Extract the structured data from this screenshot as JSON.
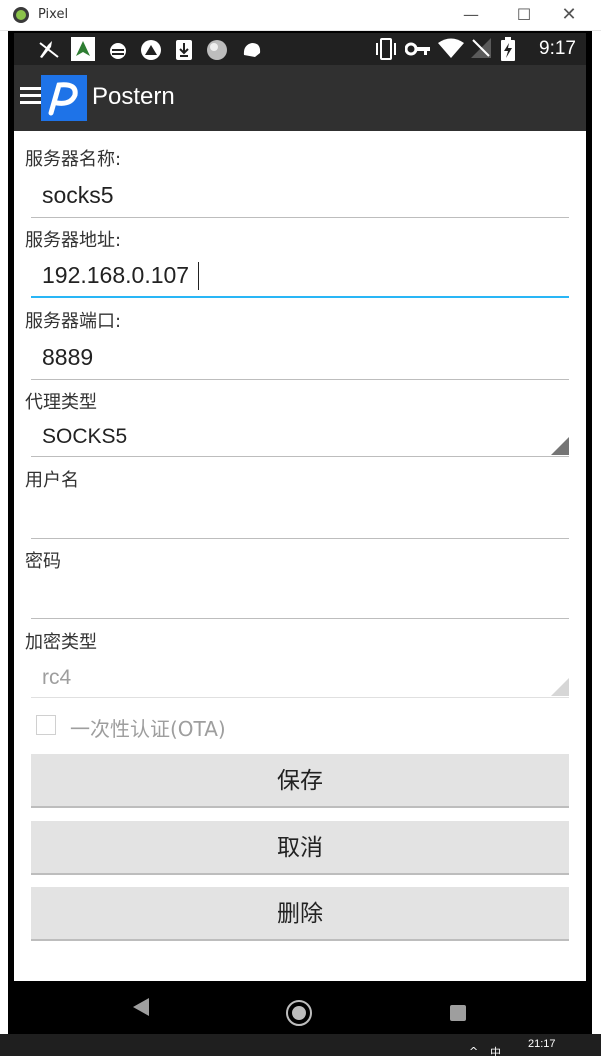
{
  "window": {
    "title": "Pixel",
    "minimize_glyph": "—",
    "maximize_glyph": "☐",
    "close_glyph": "✕"
  },
  "statusbar": {
    "time": "9:17",
    "icons": [
      "rocket-icon",
      "nav-app-icon",
      "android-debug-icon",
      "steering-icon",
      "download-icon",
      "sphere-icon",
      "notification-icon",
      "vibrate-icon",
      "key-icon",
      "wifi-icon",
      "no-signal-icon",
      "battery-charging-icon"
    ]
  },
  "appbar": {
    "title": "Postern",
    "logo_letter": "P"
  },
  "form": {
    "server_name_label": "服务器名称:",
    "server_name_value": "socks5",
    "server_addr_label": "服务器地址:",
    "server_addr_value": "192.168.0.107",
    "server_port_label": "服务器端口:",
    "server_port_value": "8889",
    "proxy_type_label": "代理类型",
    "proxy_type_value": "SOCKS5",
    "username_label": "用户名",
    "username_value": "",
    "password_label": "密码",
    "password_value": "",
    "encryption_label": "加密类型",
    "encryption_value": "rc4",
    "ota_label": "一次性认证(OTA)",
    "ota_checked": false
  },
  "buttons": {
    "save": "保存",
    "cancel": "取消",
    "delete": "删除"
  },
  "taskbar": {
    "time": "21:17",
    "ime": "中",
    "tray_caret": "^"
  },
  "colors": {
    "accent_focus": "#29b6f6",
    "appbar": "#303030",
    "statusbar": "#212121",
    "logo_bg": "#1e73e8"
  }
}
